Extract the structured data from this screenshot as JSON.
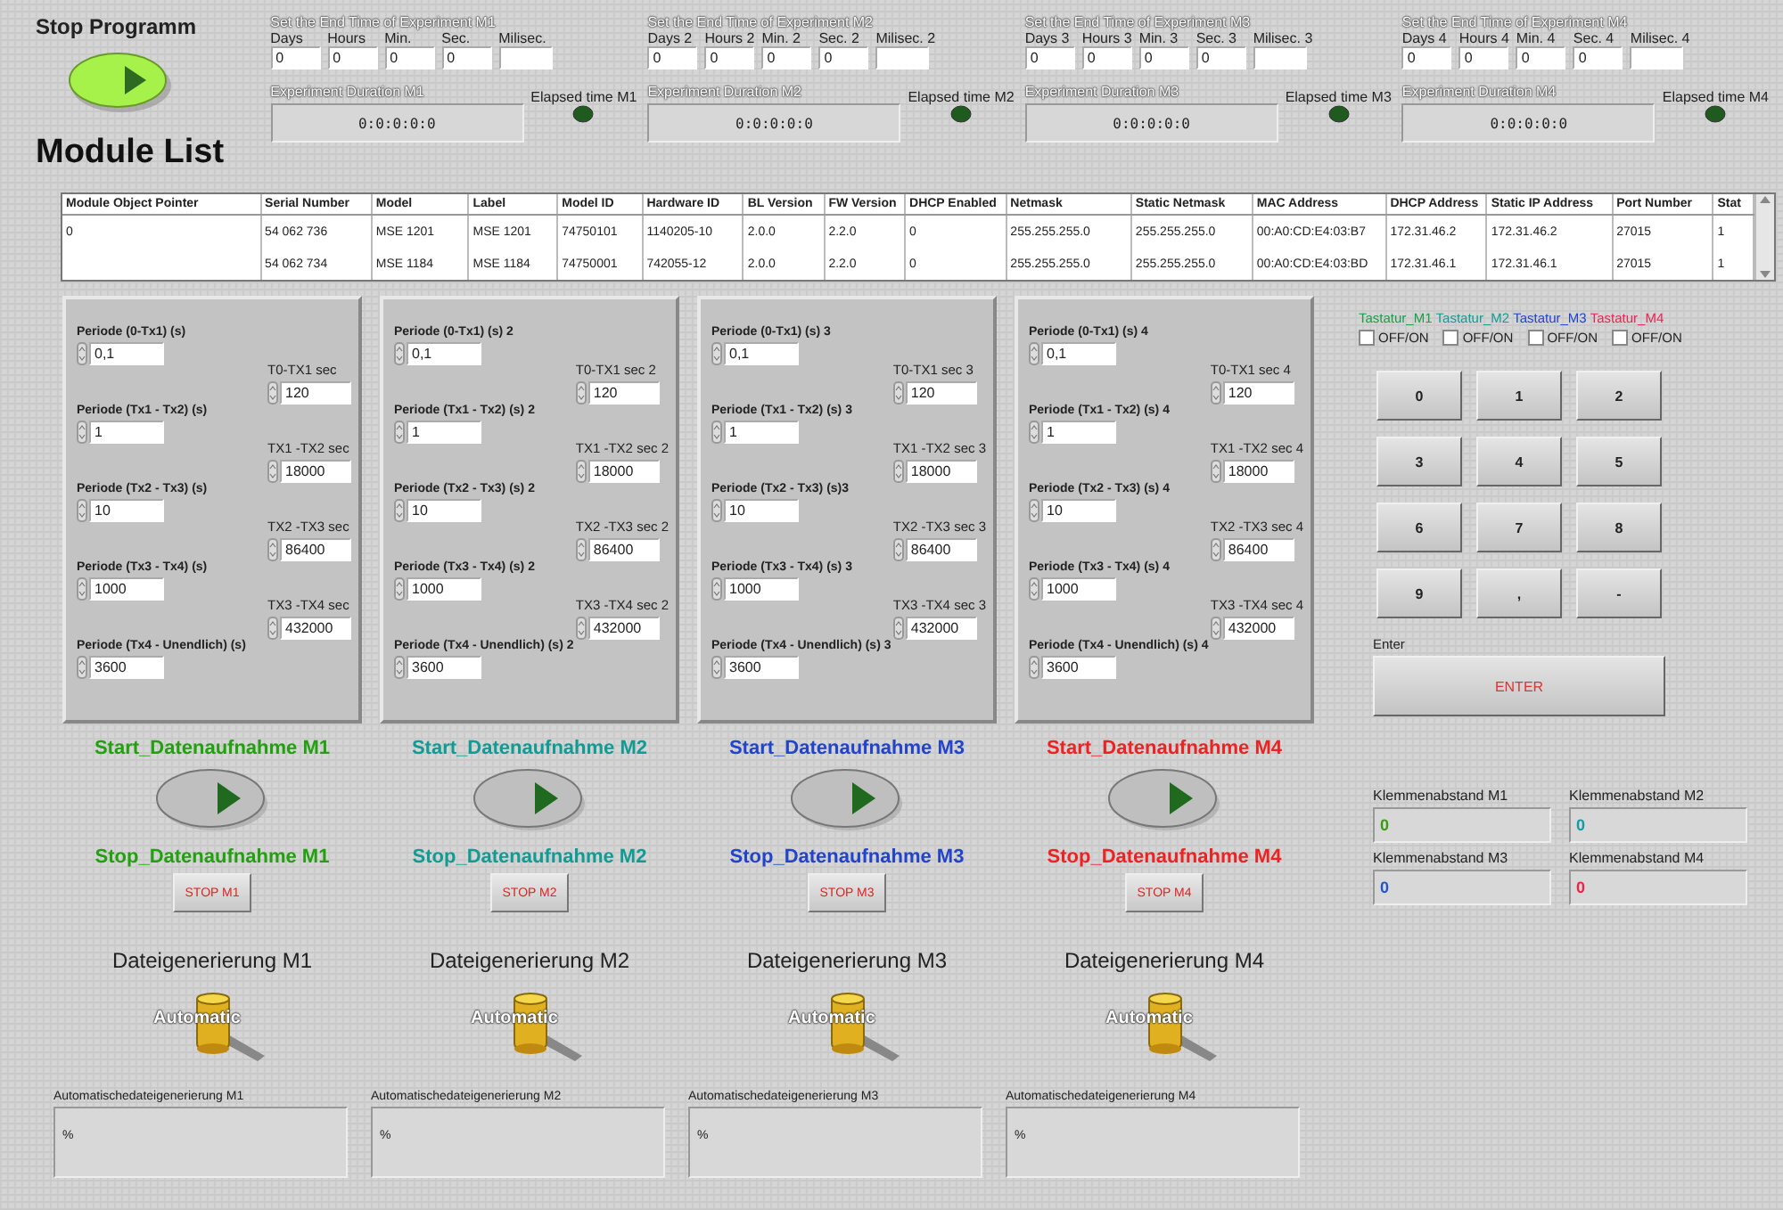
{
  "stop_program": {
    "label": "Stop Programm"
  },
  "experiments": [
    {
      "title": "Set the End Time of Experiment M1",
      "fields": [
        {
          "label": "Days",
          "value": "0"
        },
        {
          "label": "Hours",
          "value": "0"
        },
        {
          "label": "Min.",
          "value": "0"
        },
        {
          "label": "Sec.",
          "value": "0"
        },
        {
          "label": "Milisec."
        }
      ],
      "duration_label": "Experiment Duration M1",
      "duration": "0:0:0:0:0",
      "elapsed_label": "Elapsed time M1",
      "elapsed_lit": false
    },
    {
      "title": "Set the End Time of Experiment M2",
      "fields": [
        {
          "label": "Days 2",
          "value": "0"
        },
        {
          "label": "Hours 2",
          "value": "0"
        },
        {
          "label": "Min. 2",
          "value": "0"
        },
        {
          "label": "Sec. 2",
          "value": "0"
        },
        {
          "label": "Milisec. 2"
        }
      ],
      "duration_label": "Experiment Duration M2",
      "duration": "0:0:0:0:0",
      "elapsed_label": "Elapsed time M2",
      "elapsed_lit": false
    },
    {
      "title": "Set the End Time of Experiment M3",
      "fields": [
        {
          "label": "Days 3",
          "value": "0"
        },
        {
          "label": "Hours 3",
          "value": "0"
        },
        {
          "label": "Min. 3",
          "value": "0"
        },
        {
          "label": "Sec. 3",
          "value": "0"
        },
        {
          "label": "Milisec. 3"
        }
      ],
      "duration_label": "Experiment Duration M3",
      "duration": "0:0:0:0:0",
      "elapsed_label": "Elapsed time M3",
      "elapsed_lit": false
    },
    {
      "title": "Set the End Time of Experiment M4",
      "fields": [
        {
          "label": "Days 4",
          "value": "0"
        },
        {
          "label": "Hours 4",
          "value": "0"
        },
        {
          "label": "Min. 4",
          "value": "0"
        },
        {
          "label": "Sec. 4",
          "value": "0"
        },
        {
          "label": "Milisec. 4"
        }
      ],
      "duration_label": "Experiment Duration M4",
      "duration": "0:0:0:0:0",
      "elapsed_label": "Elapsed time M4",
      "elapsed_lit": false
    }
  ],
  "module_list": {
    "title": "Module List",
    "columns": [
      "Module Object Pointer",
      "Serial Number",
      "Model",
      "Label",
      "Model ID",
      "Hardware ID",
      "BL Version",
      "FW Version",
      "DHCP Enabled",
      "Netmask",
      "Static Netmask",
      "MAC Address",
      "DHCP Address",
      "Static IP Address",
      "Port Number",
      "Stat"
    ],
    "rows": [
      [
        "0",
        "54 062 736",
        "MSE 1201",
        "MSE 1201",
        "74750101",
        "1140205-10",
        "2.0.0",
        "2.2.0",
        "0",
        "255.255.255.0",
        "255.255.255.0",
        "00:A0:CD:E4:03:B7",
        "172.31.46.2",
        "172.31.46.2",
        "27015",
        "1"
      ],
      [
        "",
        "54 062 734",
        "MSE 1184",
        "MSE 1184",
        "74750001",
        "742055-12",
        "2.0.0",
        "2.2.0",
        "0",
        "255.255.255.0",
        "255.255.255.0",
        "00:A0:CD:E4:03:BD",
        "172.31.46.1",
        "172.31.46.1",
        "27015",
        "1"
      ]
    ]
  },
  "modules": [
    {
      "periods": [
        {
          "label": "Periode (0-Tx1) (s)",
          "value": "0,1"
        },
        {
          "label": "Periode (Tx1 - Tx2) (s)",
          "value": "1"
        },
        {
          "label": "Periode (Tx2 - Tx3) (s)",
          "value": "10"
        },
        {
          "label": "Periode (Tx3 - Tx4)  (s)",
          "value": "1000"
        },
        {
          "label": "Periode (Tx4 - Unendlich) (s)",
          "value": "3600"
        }
      ],
      "seconds": [
        {
          "label": "T0-TX1 sec",
          "value": "120"
        },
        {
          "label": "TX1 -TX2 sec",
          "value": "18000"
        },
        {
          "label": "TX2 -TX3 sec",
          "value": "86400"
        },
        {
          "label": "TX3 -TX4 sec",
          "value": "432000"
        }
      ],
      "color": "#22a010",
      "start_label": "Start_Datenaufnahme M1",
      "stop_label": "Stop_Datenaufnahme M1",
      "stop_button": "STOP M1",
      "file_label": "Dateigenerierung M1",
      "toggle_label": "Automatic",
      "auto_label": "Automatischedateigenerierung M1",
      "auto_value": "%"
    },
    {
      "periods": [
        {
          "label": "Periode (0-Tx1) (s) 2",
          "value": "0,1"
        },
        {
          "label": "Periode (Tx1 - Tx2) (s) 2",
          "value": "1"
        },
        {
          "label": "Periode (Tx2 - Tx3) (s) 2",
          "value": "10"
        },
        {
          "label": "Periode (Tx3 - Tx4)  (s) 2",
          "value": "1000"
        },
        {
          "label": "Periode (Tx4 - Unendlich) (s) 2",
          "value": "3600"
        }
      ],
      "seconds": [
        {
          "label": "T0-TX1 sec 2",
          "value": "120"
        },
        {
          "label": "TX1 -TX2 sec 2",
          "value": "18000"
        },
        {
          "label": "TX2 -TX3 sec  2",
          "value": "86400"
        },
        {
          "label": "TX3 -TX4 sec 2",
          "value": "432000"
        }
      ],
      "color": "#109c94",
      "start_label": "Start_Datenaufnahme M2",
      "stop_label": "Stop_Datenaufnahme M2",
      "stop_button": "STOP M2",
      "file_label": "Dateigenerierung M2",
      "toggle_label": "Automatic",
      "auto_label": "Automatischedateigenerierung  M2",
      "auto_value": "%"
    },
    {
      "periods": [
        {
          "label": "Periode (0-Tx1) (s) 3",
          "value": "0,1"
        },
        {
          "label": "Periode (Tx1 - Tx2) (s) 3",
          "value": "1"
        },
        {
          "label": "Periode (Tx2 - Tx3) (s)3",
          "value": "10"
        },
        {
          "label": "Periode (Tx3 - Tx4)  (s) 3",
          "value": "1000"
        },
        {
          "label": "Periode (Tx4 - Unendlich) (s) 3",
          "value": "3600"
        }
      ],
      "seconds": [
        {
          "label": "T0-TX1 sec 3",
          "value": "120"
        },
        {
          "label": "TX1 -TX2 sec 3",
          "value": "18000"
        },
        {
          "label": "TX2 -TX3 sec  3",
          "value": "86400"
        },
        {
          "label": "TX3 -TX4 sec 3",
          "value": "432000"
        }
      ],
      "color": "#2244cc",
      "start_label": "Start_Datenaufnahme M3",
      "stop_label": "Stop_Datenaufnahme M3",
      "stop_button": "STOP M3",
      "file_label": "Dateigenerierung M3",
      "toggle_label": "Automatic",
      "auto_label": "Automatischedateigenerierung  M3",
      "auto_value": "%"
    },
    {
      "periods": [
        {
          "label": "Periode (0-Tx1) (s) 4",
          "value": "0,1"
        },
        {
          "label": "Periode (Tx1 - Tx2) (s) 4",
          "value": "1"
        },
        {
          "label": "Periode (Tx2 - Tx3) (s) 4",
          "value": "10"
        },
        {
          "label": "Periode (Tx3 - Tx4)  (s) 4",
          "value": "1000"
        },
        {
          "label": "Periode (Tx4 - Unendlich) (s) 4",
          "value": "3600"
        }
      ],
      "seconds": [
        {
          "label": "T0-TX1 sec 4",
          "value": "120"
        },
        {
          "label": "TX1 -TX2 sec 4",
          "value": "18000"
        },
        {
          "label": "TX2 -TX3 sec  4",
          "value": "86400"
        },
        {
          "label": "TX3 -TX4 sec 4",
          "value": "432000"
        }
      ],
      "color": "#ee2222",
      "start_label": "Start_Datenaufnahme M4",
      "stop_label": "Stop_Datenaufnahme M4",
      "stop_button": "STOP M4",
      "file_label": "Dateigenerierung M4",
      "toggle_label": "Automatic",
      "auto_label": "Automatischedateigenerierung  M4",
      "auto_value": "%"
    }
  ],
  "keyboard": {
    "switches": [
      {
        "label": "Tastatur_M1",
        "color": "#18a048",
        "option": "OFF/ON",
        "checked": false
      },
      {
        "label": "Tastatur_M2",
        "color": "#109c94",
        "option": "OFF/ON",
        "checked": false
      },
      {
        "label": "Tastatur_M3",
        "color": "#2244cc",
        "option": "OFF/ON",
        "checked": false
      },
      {
        "label": "Tastatur_M4",
        "color": "#ee2255",
        "option": "OFF/ON",
        "checked": false
      }
    ],
    "keys": [
      "0",
      "1",
      "2",
      "3",
      "4",
      "5",
      "6",
      "7",
      "8",
      "9",
      ",",
      "-"
    ],
    "enter_label": "Enter",
    "enter_button": "ENTER"
  },
  "distances": [
    {
      "label": "Klemmenabstand M1",
      "value": "0",
      "color": "#3a9a10"
    },
    {
      "label": "Klemmenabstand M2",
      "value": "0",
      "color": "#109ca4"
    },
    {
      "label": "Klemmenabstand M3",
      "value": "0",
      "color": "#2255cc"
    },
    {
      "label": "Klemmenabstand M4",
      "value": "0",
      "color": "#ee2244"
    }
  ]
}
